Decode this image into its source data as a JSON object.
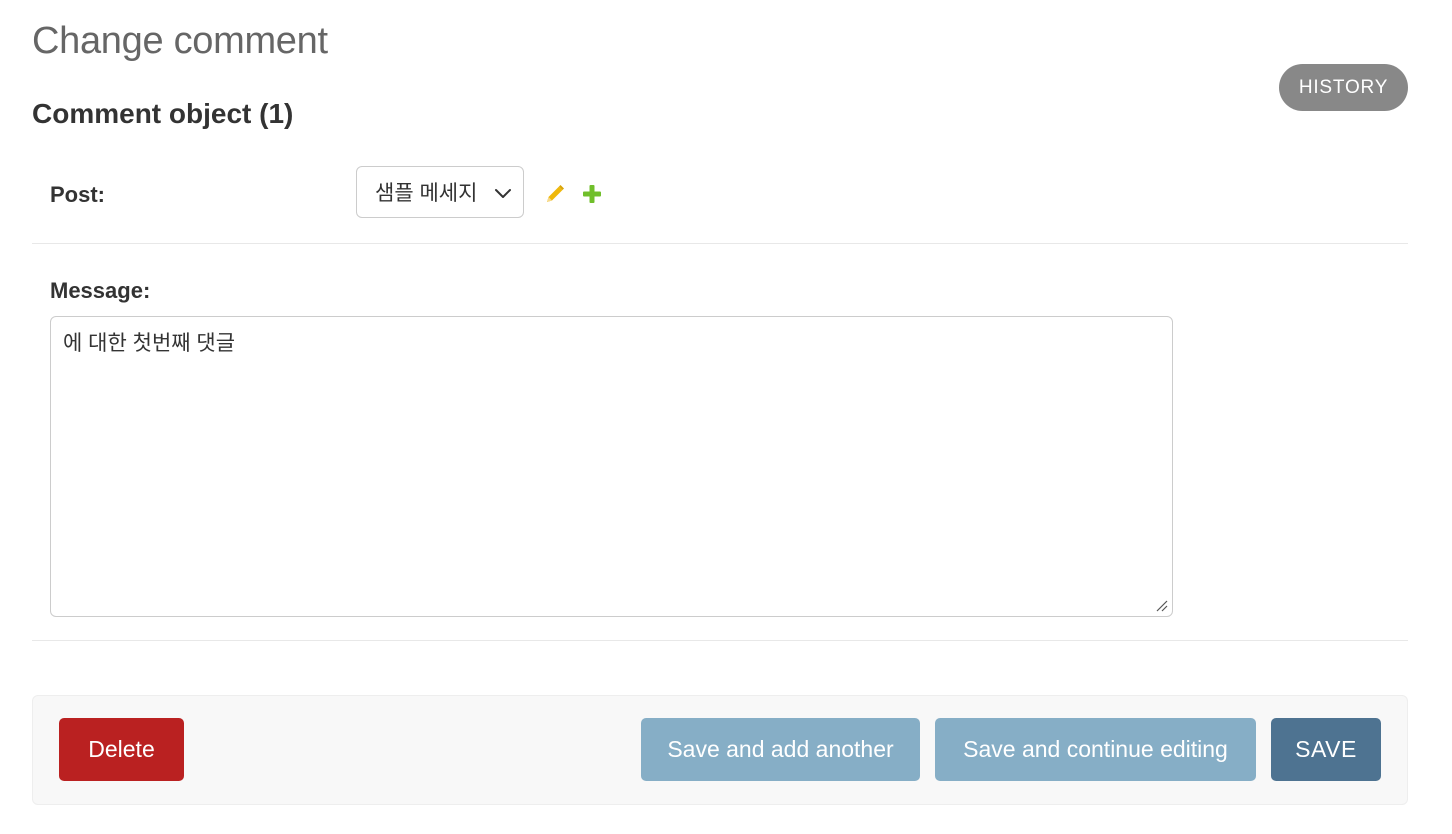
{
  "page": {
    "title": "Change comment",
    "history_label": "HISTORY",
    "object_title": "Comment object (1)"
  },
  "form": {
    "post": {
      "label": "Post:",
      "selected": "샘플 메세지"
    },
    "message": {
      "label": "Message:",
      "value": "에 대한 첫번째 댓글"
    }
  },
  "actions": {
    "delete_label": "Delete",
    "save_add_another_label": "Save and add another",
    "save_continue_label": "Save and continue editing",
    "save_label": "SAVE"
  },
  "icons": {
    "edit": "pencil-icon",
    "add": "plus-icon",
    "dropdown": "chevron-down-icon"
  },
  "colors": {
    "delete": "#ba2121",
    "secondary_save": "#86aec6",
    "primary_save": "#4e7391",
    "history": "#888888",
    "edit_icon": "#efb80b",
    "add_icon": "#70bf2b"
  }
}
